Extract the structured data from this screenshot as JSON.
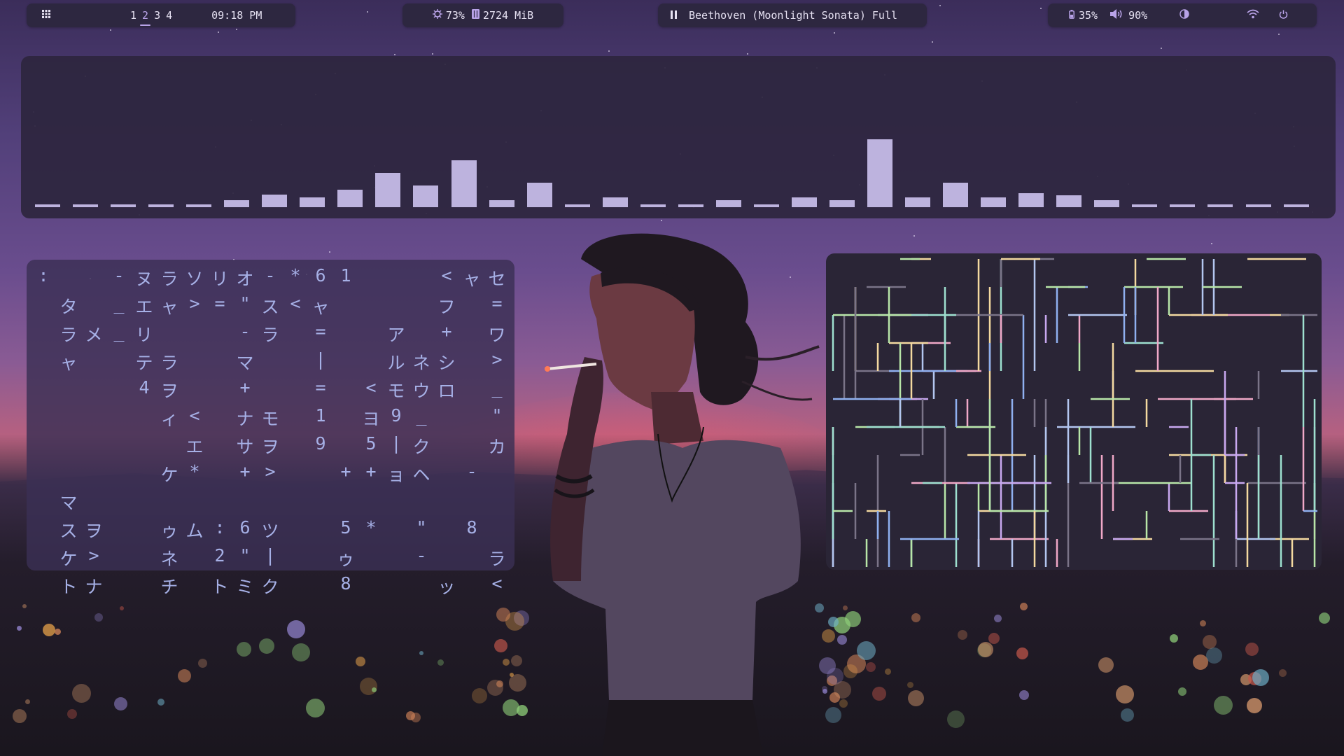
{
  "topbar": {
    "launcher_icon": "grid-icon",
    "workspaces": [
      "1",
      "2",
      "3",
      "4"
    ],
    "active_workspace": 1,
    "clock": "09:18 PM",
    "cpu": "73%",
    "memory": "2724 MiB",
    "media_state_icon": "pause-icon",
    "media_title": "Beethoven (Moonlight Sonata) Full",
    "battery": "35%",
    "volume": "90%",
    "right_icons": [
      "battery-icon",
      "volume-icon",
      "brightness-icon",
      "wifi-icon",
      "power-icon"
    ]
  },
  "visualizer": {
    "levels": [
      0.03,
      0.03,
      0.03,
      0.03,
      0.03,
      0.07,
      0.13,
      0.1,
      0.18,
      0.35,
      0.22,
      0.48,
      0.07,
      0.25,
      0.03,
      0.1,
      0.03,
      0.03,
      0.07,
      0.03,
      0.1,
      0.07,
      0.69,
      0.1,
      0.25,
      0.1,
      0.14,
      0.12,
      0.07,
      0.03,
      0.03,
      0.03,
      0.03,
      0.03
    ],
    "bar_color": "#bdb3de"
  },
  "matrix": {
    "columns": [
      [
        [
          0,
          ":"
        ]
      ],
      [
        [
          1,
          "タ"
        ],
        [
          2,
          "ラ"
        ],
        [
          3,
          "ャ"
        ],
        [
          8,
          "マ"
        ],
        [
          9,
          "ス"
        ],
        [
          10,
          "ケ"
        ],
        [
          11,
          "ト"
        ]
      ],
      [
        [
          2,
          "メ"
        ],
        [
          9,
          "ヲ"
        ],
        [
          10,
          ">"
        ],
        [
          11,
          "ナ"
        ]
      ],
      [
        [
          0,
          "-"
        ],
        [
          1,
          "_"
        ],
        [
          2,
          "_"
        ]
      ],
      [
        [
          0,
          "ヌ"
        ],
        [
          1,
          "エ"
        ],
        [
          2,
          "リ"
        ],
        [
          3,
          "テ"
        ],
        [
          4,
          "4"
        ]
      ],
      [
        [
          0,
          "ラ"
        ],
        [
          1,
          "ャ"
        ],
        [
          3,
          "ラ"
        ],
        [
          4,
          "ヲ"
        ],
        [
          5,
          "ィ"
        ],
        [
          7,
          "ケ"
        ],
        [
          9,
          "ゥ"
        ],
        [
          10,
          "ネ"
        ],
        [
          11,
          "チ"
        ]
      ],
      [
        [
          0,
          "ソ"
        ],
        [
          1,
          ">"
        ],
        [
          5,
          "<"
        ],
        [
          6,
          "エ"
        ],
        [
          7,
          "*"
        ],
        [
          9,
          "ム"
        ]
      ],
      [
        [
          0,
          "リ"
        ],
        [
          1,
          "="
        ],
        [
          9,
          ":"
        ],
        [
          10,
          "2"
        ],
        [
          11,
          "ト"
        ]
      ],
      [
        [
          0,
          "オ"
        ],
        [
          1,
          "\""
        ],
        [
          2,
          "-"
        ],
        [
          3,
          "マ"
        ],
        [
          4,
          "+"
        ],
        [
          5,
          "ナ"
        ],
        [
          6,
          "サ"
        ],
        [
          7,
          "+"
        ],
        [
          9,
          "6"
        ],
        [
          10,
          "\""
        ],
        [
          11,
          "ミ"
        ]
      ],
      [
        [
          0,
          "-"
        ],
        [
          1,
          "ス"
        ],
        [
          2,
          "ラ"
        ],
        [
          5,
          "モ"
        ],
        [
          6,
          "ヲ"
        ],
        [
          7,
          ">"
        ],
        [
          9,
          "ツ"
        ],
        [
          10,
          "|"
        ],
        [
          11,
          "ク"
        ]
      ],
      [
        [
          0,
          "*"
        ],
        [
          1,
          "<"
        ]
      ],
      [
        [
          0,
          "6"
        ],
        [
          1,
          "ャ"
        ],
        [
          2,
          "="
        ],
        [
          3,
          "|"
        ],
        [
          4,
          "="
        ],
        [
          5,
          "1"
        ],
        [
          6,
          "9"
        ]
      ],
      [
        [
          0,
          "1"
        ],
        [
          7,
          "+"
        ],
        [
          9,
          "5"
        ],
        [
          10,
          "ゥ"
        ],
        [
          11,
          "8"
        ]
      ],
      [
        [
          4,
          "<"
        ],
        [
          5,
          "ヨ"
        ],
        [
          6,
          "5"
        ],
        [
          7,
          "+"
        ],
        [
          9,
          "*"
        ]
      ],
      [
        [
          2,
          "ア"
        ],
        [
          3,
          "ル"
        ],
        [
          4,
          "モ"
        ],
        [
          5,
          "9"
        ],
        [
          6,
          "|"
        ],
        [
          7,
          "ョ"
        ]
      ],
      [
        [
          3,
          "ネ"
        ],
        [
          4,
          "ウ"
        ],
        [
          5,
          "_"
        ],
        [
          6,
          "ク"
        ],
        [
          7,
          "ヘ"
        ],
        [
          9,
          "\""
        ],
        [
          10,
          "-"
        ]
      ],
      [
        [
          0,
          "<"
        ],
        [
          1,
          "フ"
        ],
        [
          2,
          "+"
        ],
        [
          3,
          "シ"
        ],
        [
          4,
          "ロ"
        ],
        [
          11,
          "ッ"
        ]
      ],
      [
        [
          0,
          "ャ"
        ],
        [
          7,
          "-"
        ],
        [
          9,
          "8"
        ]
      ],
      [
        [
          0,
          "セ"
        ],
        [
          1,
          "="
        ],
        [
          2,
          "ワ"
        ],
        [
          3,
          ">"
        ],
        [
          4,
          "_"
        ],
        [
          5,
          "\""
        ],
        [
          6,
          "カ"
        ],
        [
          10,
          "ラ"
        ],
        [
          11,
          "<"
        ]
      ]
    ],
    "highlight": [
      [
        1,
        4,
        0
      ],
      [
        1,
        6,
        6
      ],
      [
        2,
        1,
        2
      ],
      [
        4,
        12,
        9
      ],
      [
        3,
        9,
        0
      ],
      [
        5,
        11,
        0
      ],
      [
        8,
        14,
        6
      ],
      [
        16,
        4,
        4
      ],
      [
        17,
        6,
        3
      ],
      [
        18,
        6,
        6
      ],
      [
        18,
        10,
        3
      ],
      [
        14,
        6,
        5
      ]
    ],
    "char_color": "#a6b0e6"
  },
  "pipes": {
    "colors": [
      "#b3c6f0",
      "#f4d9a0",
      "#b8e6a8",
      "#f0a8c8",
      "#8fb0f0",
      "#9ee0d0",
      "#c8a8f0",
      "#7a7488"
    ]
  }
}
